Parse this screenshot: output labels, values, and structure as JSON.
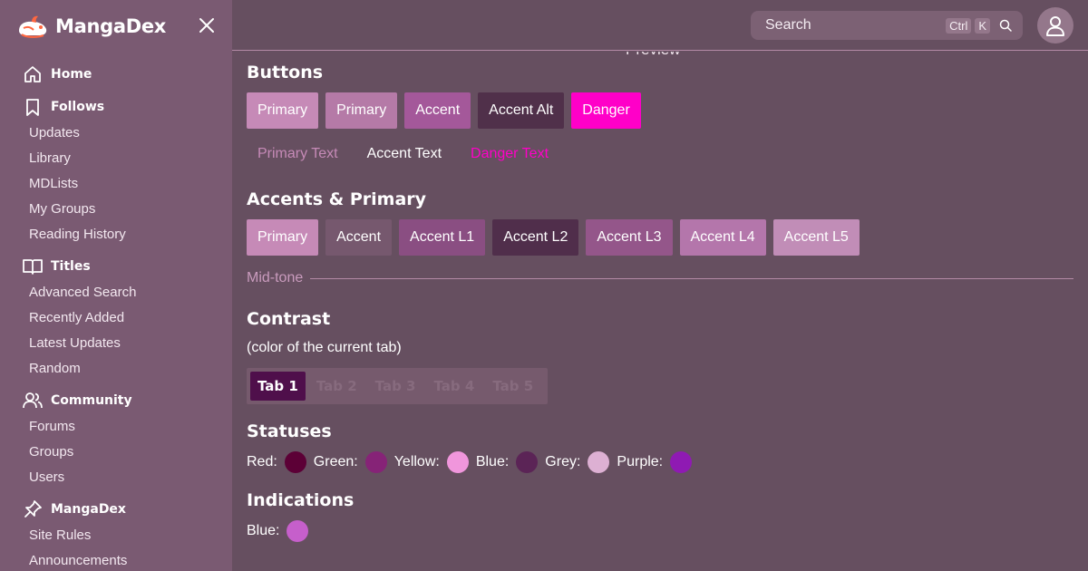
{
  "brand": {
    "name": "MangaDex"
  },
  "sidebar": {
    "groups": [
      {
        "title": "Home",
        "icon": "home-icon",
        "items": []
      },
      {
        "title": "Follows",
        "icon": "bookmark-icon",
        "items": [
          "Updates",
          "Library",
          "MDLists",
          "My Groups",
          "Reading History"
        ]
      },
      {
        "title": "Titles",
        "icon": "book-open-icon",
        "items": [
          "Advanced Search",
          "Recently Added",
          "Latest Updates",
          "Random"
        ]
      },
      {
        "title": "Community",
        "icon": "users-icon",
        "items": [
          "Forums",
          "Groups",
          "Users"
        ]
      },
      {
        "title": "MangaDex",
        "icon": "pin-icon",
        "items": [
          "Site Rules",
          "Announcements"
        ]
      }
    ]
  },
  "header": {
    "search_label": "Search",
    "kbd_ctrl": "Ctrl",
    "kbd_k": "K"
  },
  "main": {
    "preview_title": "Preview",
    "buttons": {
      "title": "Buttons",
      "filled": [
        {
          "label": "Primary",
          "color": "#c68ab7"
        },
        {
          "label": "Primary",
          "color": "#b57aa7"
        },
        {
          "label": "Accent",
          "color": "#a4589a"
        },
        {
          "label": "Accent Alt",
          "color": "#50304a"
        },
        {
          "label": "Danger",
          "color": "#ff00c8"
        }
      ],
      "text": [
        {
          "label": "Primary Text",
          "color": "#c68ab7"
        },
        {
          "label": "Accent Text",
          "color": "#ffffff"
        },
        {
          "label": "Danger Text",
          "color": "#ff00c8"
        }
      ]
    },
    "accents": {
      "title": "Accents & Primary",
      "items": [
        {
          "label": "Primary",
          "color": "#c68ab7"
        },
        {
          "label": "Accent",
          "color": "#76586e"
        },
        {
          "label": "Accent L1",
          "color": "#8a4e82"
        },
        {
          "label": "Accent L2",
          "color": "#502e4b"
        },
        {
          "label": "Accent L3",
          "color": "#94568a"
        },
        {
          "label": "Accent L4",
          "color": "#b476ab"
        },
        {
          "label": "Accent L5",
          "color": "#c18db7"
        }
      ]
    },
    "midtone_label": "Mid-tone",
    "contrast": {
      "title": "Contrast",
      "subtitle": "(color of the current tab)",
      "tabs": [
        "Tab 1",
        "Tab 2",
        "Tab 3",
        "Tab 4",
        "Tab 5"
      ],
      "active_tab": 0
    },
    "statuses": {
      "title": "Statuses",
      "items": [
        {
          "label": "Red:",
          "color": "#5c0036"
        },
        {
          "label": "Green:",
          "color": "#862377"
        },
        {
          "label": "Yellow:",
          "color": "#f096dc"
        },
        {
          "label": "Blue:",
          "color": "#5b2456"
        },
        {
          "label": "Grey:",
          "color": "#ddb0d3"
        },
        {
          "label": "Purple:",
          "color": "#8f1ab3"
        }
      ]
    },
    "indications": {
      "title": "Indications",
      "items": [
        {
          "label": "Blue:",
          "color": "#c65fcb"
        }
      ]
    }
  }
}
